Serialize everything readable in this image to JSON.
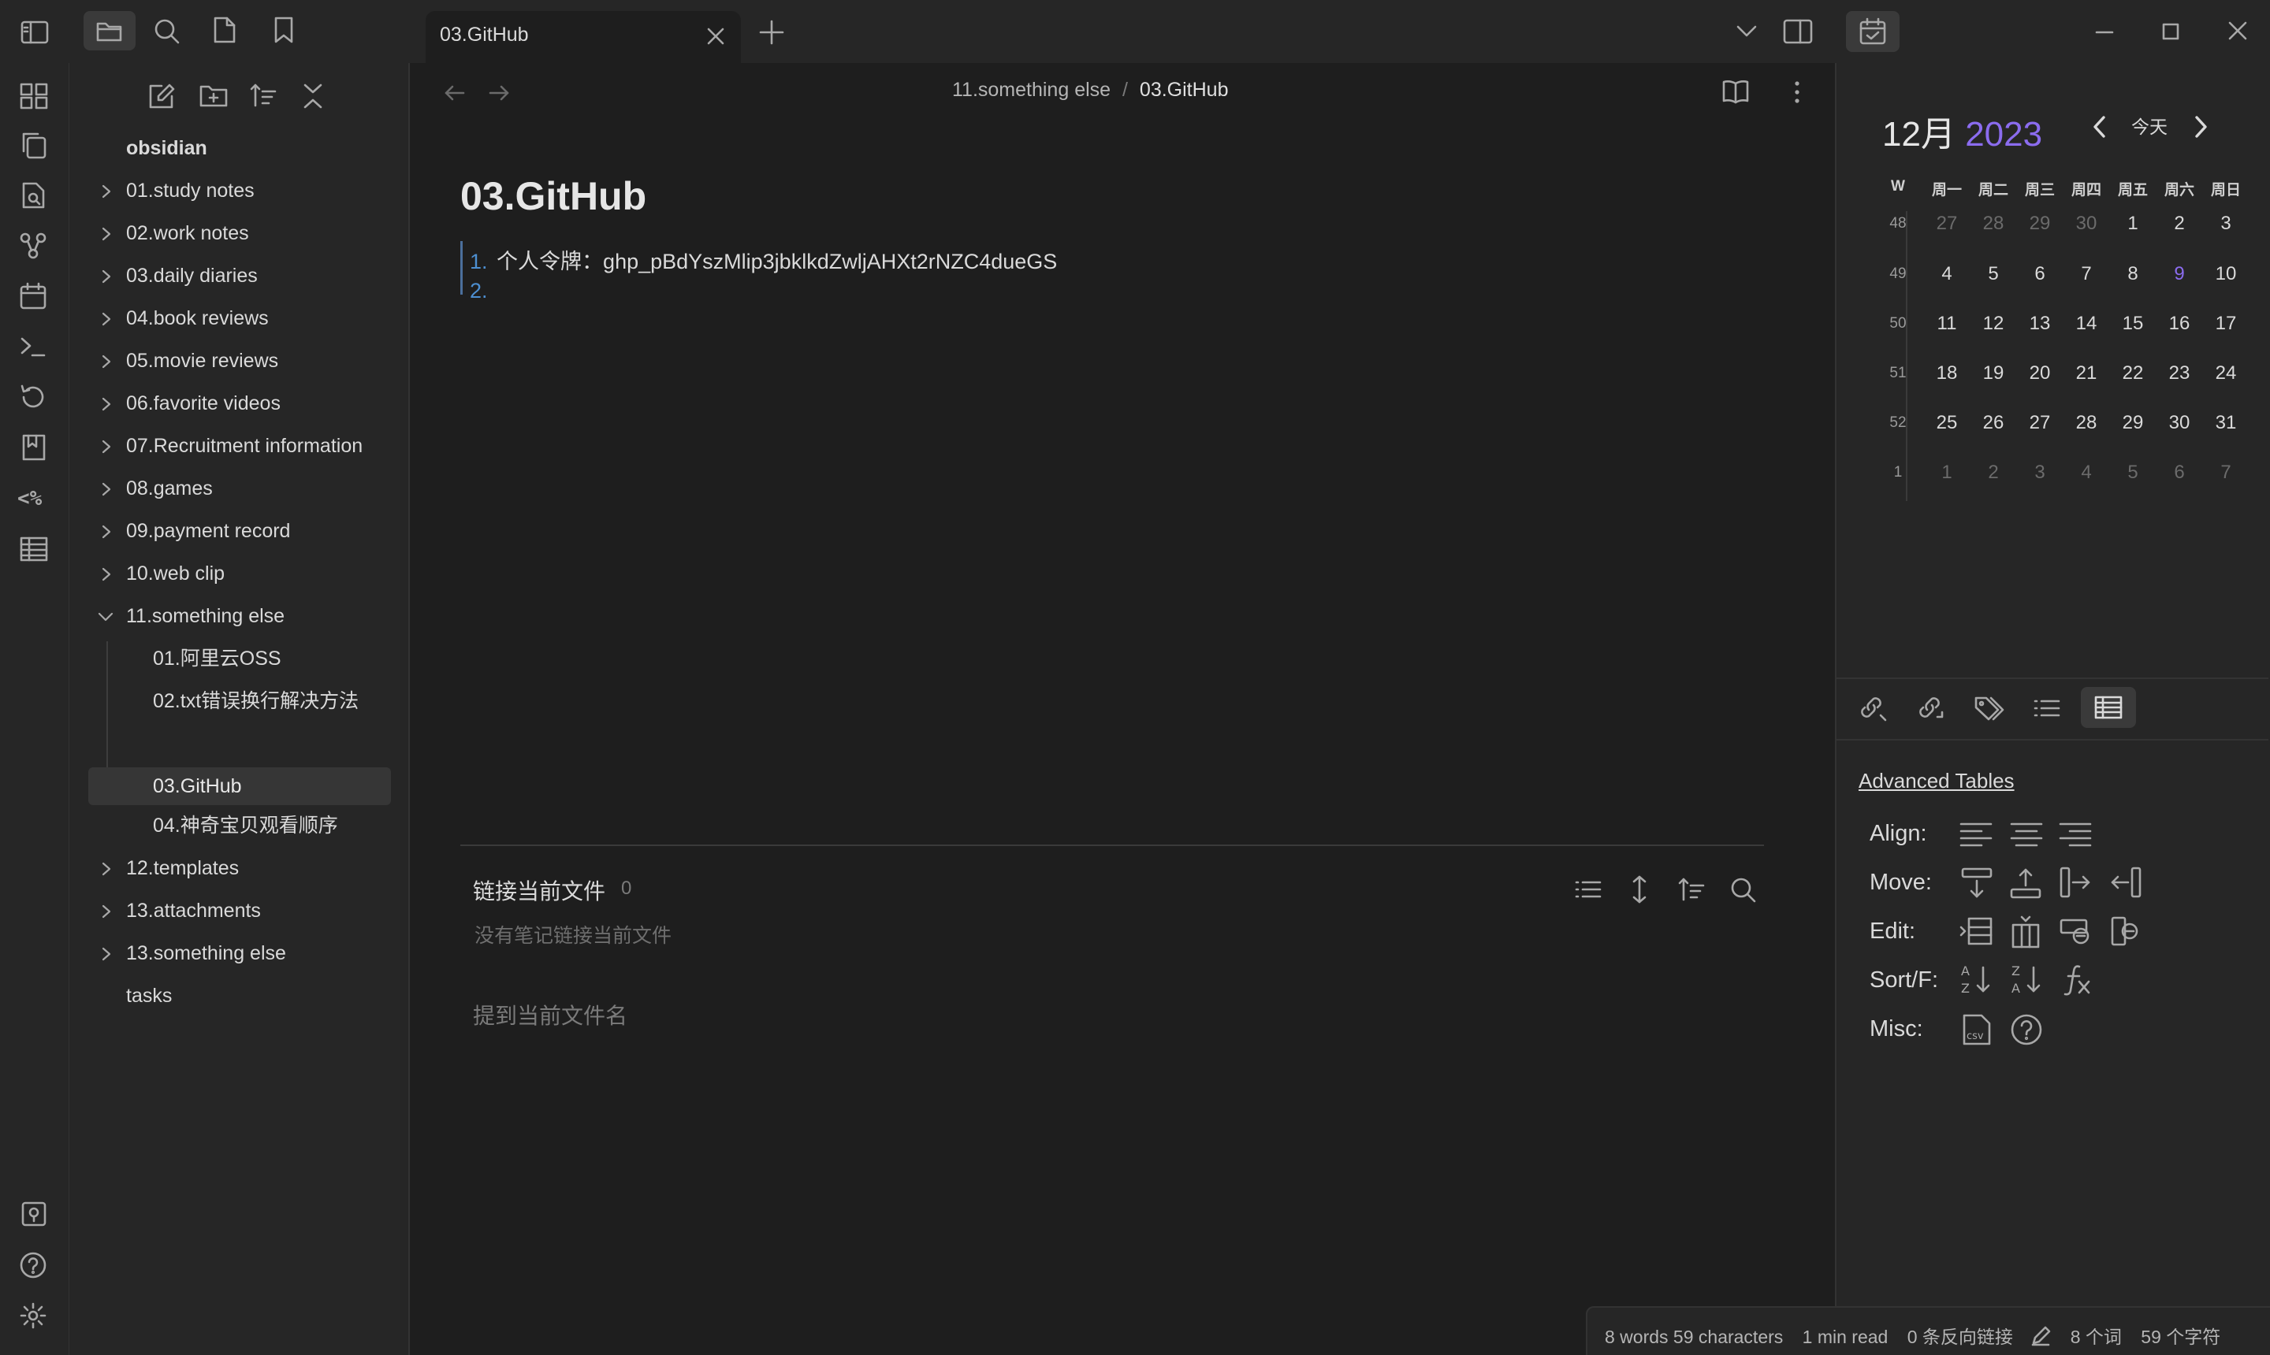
{
  "window": {
    "active_tab": "03.GitHub",
    "new_tab": "+"
  },
  "breadcrumb": {
    "folder": "11.something else",
    "separator": "/",
    "file": "03.GitHub"
  },
  "explorer": {
    "vault": "obsidian",
    "items": [
      {
        "label": "01.study notes"
      },
      {
        "label": "02.work notes"
      },
      {
        "label": "03.daily diaries"
      },
      {
        "label": "04.book reviews"
      },
      {
        "label": "05.movie reviews"
      },
      {
        "label": "06.favorite videos"
      },
      {
        "label": "07.Recruitment information"
      },
      {
        "label": "08.games"
      },
      {
        "label": "09.payment record"
      },
      {
        "label": "10.web clip"
      },
      {
        "label": "11.something else"
      },
      {
        "label": "01.阿里云OSS"
      },
      {
        "label": "02.txt错误换行解决方法"
      },
      {
        "label": "03.GitHub"
      },
      {
        "label": "04.神奇宝贝观看顺序"
      },
      {
        "label": "12.templates"
      },
      {
        "label": "13.attachments"
      },
      {
        "label": "13.something else"
      },
      {
        "label": "tasks"
      }
    ]
  },
  "note": {
    "title": "03.GitHub",
    "line1_num": "1.",
    "line1_text": "个人令牌：ghp_pBdYszMlip3jbklkdZwljAHXt2rNZC4dueGS",
    "line2_num": "2."
  },
  "backlinks": {
    "title": "链接当前文件",
    "count": "0",
    "empty": "没有笔记链接当前文件",
    "unlinked": "提到当前文件名"
  },
  "calendar": {
    "month": "12月",
    "year": "2023",
    "today": "今天",
    "headers": [
      "W",
      "周一",
      "周二",
      "周三",
      "周四",
      "周五",
      "周六",
      "周日"
    ],
    "weeks": [
      {
        "wk": "48",
        "days": [
          "27",
          "28",
          "29",
          "30",
          "1",
          "2",
          "3"
        ]
      },
      {
        "wk": "49",
        "days": [
          "4",
          "5",
          "6",
          "7",
          "8",
          "9",
          "10"
        ]
      },
      {
        "wk": "50",
        "days": [
          "11",
          "12",
          "13",
          "14",
          "15",
          "16",
          "17"
        ]
      },
      {
        "wk": "51",
        "days": [
          "18",
          "19",
          "20",
          "21",
          "22",
          "23",
          "24"
        ]
      },
      {
        "wk": "52",
        "days": [
          "25",
          "26",
          "27",
          "28",
          "29",
          "30",
          "31"
        ]
      },
      {
        "wk": "1",
        "days": [
          "1",
          "2",
          "3",
          "4",
          "5",
          "6",
          "7"
        ]
      }
    ],
    "accent": "#8b6cef"
  },
  "advanced_tables": {
    "title": "Advanced Tables",
    "align": "Align:",
    "move": "Move:",
    "edit": "Edit:",
    "sort": "Sort/F:",
    "misc": "Misc:"
  },
  "status": {
    "words": "8 words 59 characters",
    "read": "1 min read",
    "backlinks": "0 条反向链接",
    "cn_words": "8 个词",
    "cn_chars": "59 个字符"
  }
}
